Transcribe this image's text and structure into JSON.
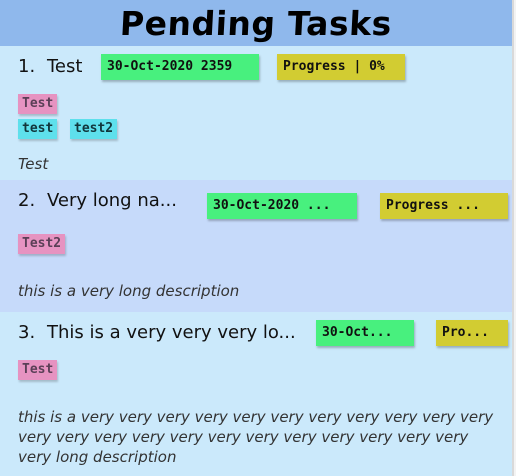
{
  "header": {
    "title": "Pending Tasks"
  },
  "tasks": [
    {
      "number": "1.",
      "title": "Test",
      "date": "30-Oct-2020 2359",
      "progress": "Progress | 0%",
      "tags": [
        "Test",
        "test",
        "test2"
      ],
      "description": "Test"
    },
    {
      "number": "2.",
      "title": "Very long na...",
      "date": "30-Oct-2020 ...",
      "progress": "Progress ...",
      "tags": [
        "Test2"
      ],
      "description": "this is a very long description"
    },
    {
      "number": "3.",
      "title": "This is a very very very lo...",
      "date": "30-Oct...",
      "progress": "Pro...",
      "tags": [
        "Test"
      ],
      "description": "this is a very very very very very very very very very very very very very very very very very very very very very very very very long description"
    }
  ],
  "colors": {
    "header_bg": "#8fb8ec",
    "task_bg": "#cbe9fb",
    "task_alt_bg": "#c6dafa",
    "date_badge": "#48f07e",
    "progress_badge": "#d2cc32",
    "tag_pink": "#e693c1",
    "tag_cyan": "#5ee0ec"
  }
}
